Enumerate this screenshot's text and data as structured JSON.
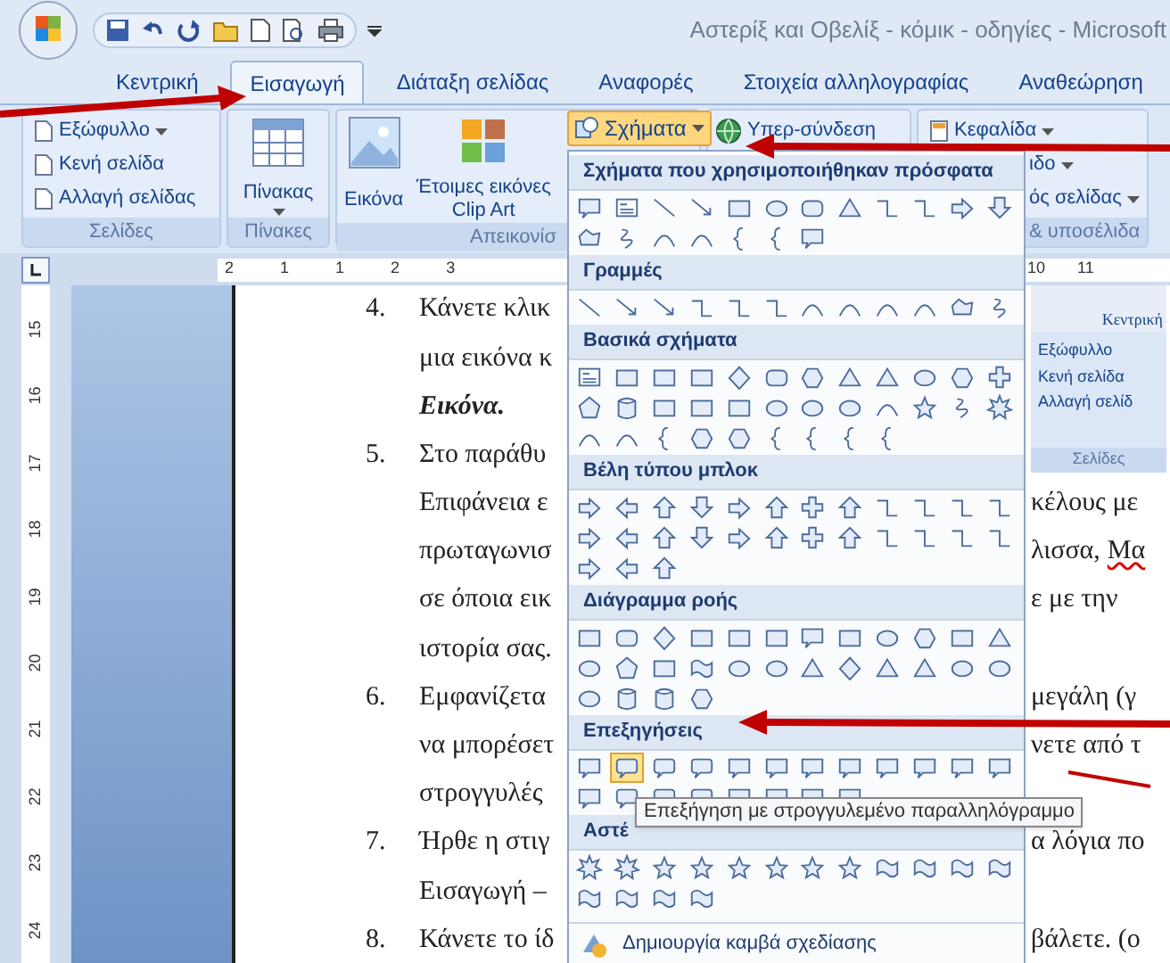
{
  "title_bar": {
    "title": "Αστερίξ και Οβελίξ - κόμικ - οδηγίες - Microsoft"
  },
  "tabs": [
    {
      "label": "Κεντρική",
      "selected": false
    },
    {
      "label": "Εισαγωγή",
      "selected": true
    },
    {
      "label": "Διάταξη σελίδας",
      "selected": false
    },
    {
      "label": "Αναφορές",
      "selected": false
    },
    {
      "label": "Στοιχεία αλληλογραφίας",
      "selected": false
    },
    {
      "label": "Αναθεώρηση",
      "selected": false
    }
  ],
  "ribbon": {
    "pages": {
      "items": [
        "Εξώφυλλο",
        "Κενή σελίδα",
        "Αλλαγή σελίδας"
      ],
      "label": "Σελίδες"
    },
    "tables": {
      "button": "Πίνακας",
      "label": "Πίνακες"
    },
    "illustrations": {
      "buttons": [
        "Εικόνα",
        "Έτοιμες εικόνες Clip Art"
      ],
      "shapes_button": "Σχήματα",
      "label": "Απεικονίσ"
    },
    "links": {
      "button": "Υπερ-σύνδεση"
    },
    "header_footer": {
      "items": [
        "Κεφαλίδα",
        "ιδο",
        "ός σελίδας"
      ],
      "label": "& υποσέλιδα"
    }
  },
  "ruler": {
    "numbers": [
      "2",
      "1",
      "1",
      "2",
      "3"
    ],
    "right_numbers": [
      "10",
      "11"
    ]
  },
  "vertical_ruler": {
    "numbers": [
      "15",
      "16",
      "17",
      "18",
      "19",
      "20",
      "21",
      "22",
      "23",
      "24"
    ]
  },
  "document": {
    "lines": [
      {
        "marker": "4.",
        "left": "Κάνετε κλικ"
      },
      {
        "left": "μια εικόνα κ"
      },
      {
        "left": "Εικόνα.",
        "kind": "emphasis"
      },
      {
        "marker": "5.",
        "left": "Στο παράθυ"
      },
      {
        "left": "Επιφάνεια ε",
        "right": "κέλους με"
      },
      {
        "left": "πρωταγωνισ",
        "right": "λισσα,",
        "right_misspelled": "Μα"
      },
      {
        "left": "σε όποια εικ",
        "right": "ε με την"
      },
      {
        "left": "ιστορία σας."
      },
      {
        "marker": "6.",
        "left": "Εμφανίζετα",
        "right": "μεγάλη (γ"
      },
      {
        "left": "να μπορέσετ",
        "right": "νετε από τ"
      },
      {
        "left": "στρογγυλές"
      },
      {
        "marker": "7.",
        "left": "Ήρθε η στιγ",
        "right": "α λόγια πο"
      },
      {
        "left": "Εισαγωγή –"
      },
      {
        "marker": "8.",
        "left": "Κάνετε το ίδ",
        "right": "βάλετε. (ο"
      }
    ]
  },
  "embedded_image": {
    "tab": "Κεντρική",
    "items": [
      "Εξώφυλλο",
      "Κενή σελίδα",
      "Αλλαγή σελίδ"
    ],
    "label": "Σελίδες"
  },
  "shapes_menu": {
    "sections": [
      {
        "title": "Σχήματα που χρησιμοποιήθηκαν πρόσφατα",
        "shapes": [
          {
            "selected": false
          },
          {
            "selected": false
          },
          {
            "selected": false
          },
          {
            "selected": false
          },
          {
            "selected": false
          },
          {
            "selected": false
          },
          {
            "selected": false
          },
          {
            "selected": false
          },
          {
            "selected": false
          },
          {
            "selected": false
          },
          {
            "selected": false
          },
          {
            "selected": false
          },
          {
            "selected": false
          },
          {
            "selected": false
          },
          {
            "selected": false
          },
          {
            "selected": false
          },
          {
            "selected": false
          },
          {
            "selected": false
          },
          {
            "selected": false
          }
        ]
      },
      {
        "title": "Γραμμές",
        "shapes": [
          {
            "selected": false
          },
          {
            "selected": false
          },
          {
            "selected": false
          },
          {
            "selected": false
          },
          {
            "selected": false
          },
          {
            "selected": false
          },
          {
            "selected": false
          },
          {
            "selected": false
          },
          {
            "selected": false
          },
          {
            "selected": false
          },
          {
            "selected": false
          },
          {
            "selected": false
          }
        ]
      },
      {
        "title": "Βασικά σχήματα",
        "shapes": [
          {
            "selected": false
          },
          {
            "selected": false
          },
          {
            "selected": false
          },
          {
            "selected": false
          },
          {
            "selected": false
          },
          {
            "selected": false
          },
          {
            "selected": false
          },
          {
            "selected": false
          },
          {
            "selected": false
          },
          {
            "selected": false
          },
          {
            "selected": false
          },
          {
            "selected": false
          },
          {
            "selected": false
          },
          {
            "selected": false
          },
          {
            "selected": false
          },
          {
            "selected": false
          },
          {
            "selected": false
          },
          {
            "selected": false
          },
          {
            "selected": false
          },
          {
            "selected": false
          },
          {
            "selected": false
          },
          {
            "selected": false
          },
          {
            "selected": false
          },
          {
            "selected": false
          },
          {
            "selected": false
          },
          {
            "selected": false
          },
          {
            "selected": false
          },
          {
            "selected": false
          },
          {
            "selected": false
          },
          {
            "selected": false
          },
          {
            "selected": false
          },
          {
            "selected": false
          },
          {
            "selected": false
          }
        ]
      },
      {
        "title": "Βέλη τύπου μπλοκ",
        "shapes": [
          {
            "selected": false
          },
          {
            "selected": false
          },
          {
            "selected": false
          },
          {
            "selected": false
          },
          {
            "selected": false
          },
          {
            "selected": false
          },
          {
            "selected": false
          },
          {
            "selected": false
          },
          {
            "selected": false
          },
          {
            "selected": false
          },
          {
            "selected": false
          },
          {
            "selected": false
          },
          {
            "selected": false
          },
          {
            "selected": false
          },
          {
            "selected": false
          },
          {
            "selected": false
          },
          {
            "selected": false
          },
          {
            "selected": false
          },
          {
            "selected": false
          },
          {
            "selected": false
          },
          {
            "selected": false
          },
          {
            "selected": false
          },
          {
            "selected": false
          },
          {
            "selected": false
          },
          {
            "selected": false
          },
          {
            "selected": false
          },
          {
            "selected": false
          }
        ]
      },
      {
        "title": "Διάγραμμα ροής",
        "shapes": [
          {
            "selected": false
          },
          {
            "selected": false
          },
          {
            "selected": false
          },
          {
            "selected": false
          },
          {
            "selected": false
          },
          {
            "selected": false
          },
          {
            "selected": false
          },
          {
            "selected": false
          },
          {
            "selected": false
          },
          {
            "selected": false
          },
          {
            "selected": false
          },
          {
            "selected": false
          },
          {
            "selected": false
          },
          {
            "selected": false
          },
          {
            "selected": false
          },
          {
            "selected": false
          },
          {
            "selected": false
          },
          {
            "selected": false
          },
          {
            "selected": false
          },
          {
            "selected": false
          },
          {
            "selected": false
          },
          {
            "selected": false
          },
          {
            "selected": false
          },
          {
            "selected": false
          },
          {
            "selected": false
          },
          {
            "selected": false
          },
          {
            "selected": false
          },
          {
            "selected": false
          }
        ]
      },
      {
        "title": "Επεξηγήσεις",
        "shapes": [
          {
            "selected": false
          },
          {
            "selected": true
          },
          {
            "selected": false
          },
          {
            "selected": false
          },
          {
            "selected": false
          },
          {
            "selected": false
          },
          {
            "selected": false
          },
          {
            "selected": false
          },
          {
            "selected": false
          },
          {
            "selected": false
          },
          {
            "selected": false
          },
          {
            "selected": false
          },
          {
            "selected": false
          },
          {
            "selected": false
          },
          {
            "selected": false
          },
          {
            "selected": false
          },
          {
            "selected": false
          },
          {
            "selected": false
          },
          {
            "selected": false
          },
          {
            "selected": false
          }
        ]
      },
      {
        "title": "Αστέ",
        "shapes": [
          {
            "selected": false
          },
          {
            "selected": false
          },
          {
            "selected": false
          },
          {
            "selected": false
          },
          {
            "selected": false
          },
          {
            "selected": false
          },
          {
            "selected": false
          },
          {
            "selected": false
          },
          {
            "selected": false
          },
          {
            "selected": false
          },
          {
            "selected": false
          },
          {
            "selected": false
          },
          {
            "selected": false
          },
          {
            "selected": false
          },
          {
            "selected": false
          },
          {
            "selected": false
          }
        ]
      }
    ],
    "footer": "Δημιουργία καμβά σχεδίασης",
    "tooltip": "Επεξήγηση με στρογγυλεμένο παραλληλόγραμμο"
  }
}
